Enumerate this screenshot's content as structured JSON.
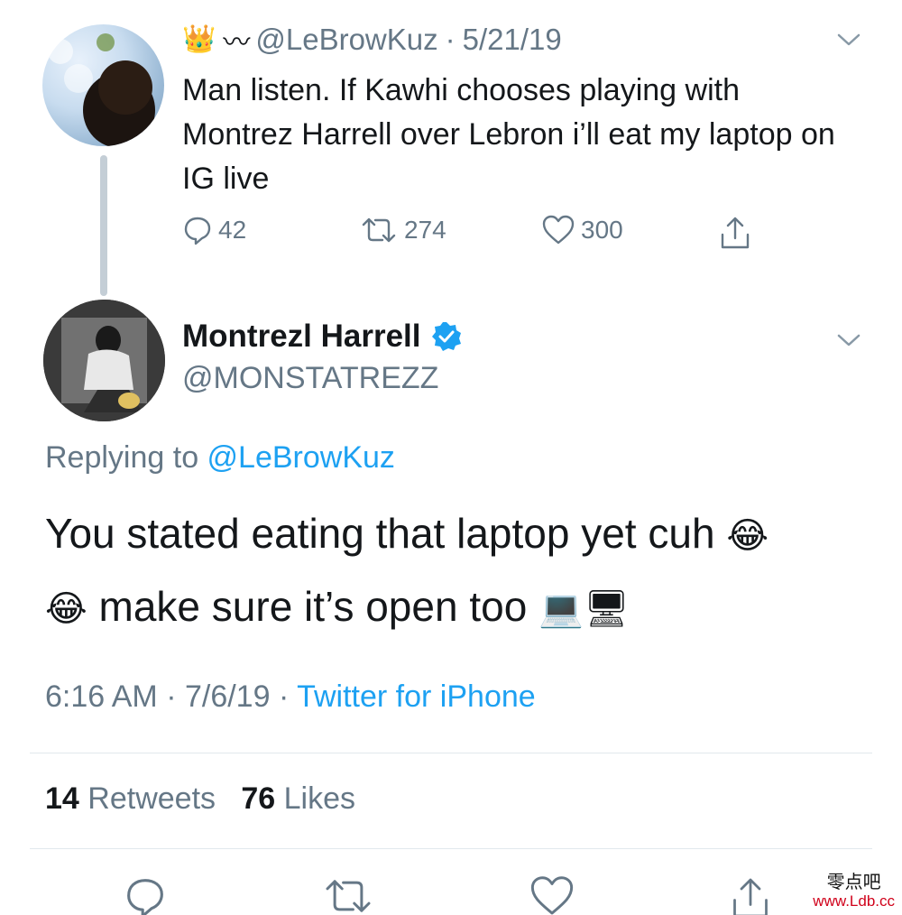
{
  "parent_tweet": {
    "handle": "@LeBrowKuz",
    "date_sep": "·",
    "date": "5/21/19",
    "crown_glyph": "👑",
    "wave_glyph": "〰",
    "text": "Man listen. If Kawhi chooses playing with Montrez Harrell over Lebron i’ll eat my laptop on IG live",
    "replies": "42",
    "retweets": "274",
    "likes": "300"
  },
  "main_tweet": {
    "display_name": "Montrezl Harrell",
    "handle": "@MONSTATREZZ",
    "replying_prefix": "Replying to ",
    "replying_to": "@LeBrowKuz",
    "text_part1": "You stated eating that laptop yet cuh ",
    "emoji_laugh": "😂",
    "text_part2": " make sure it’s open too ",
    "emoji_laptop": "💻",
    "emoji_desktop": "🖥",
    "time": "6:16 AM",
    "meta_sep": " · ",
    "date": "7/6/19",
    "source": "Twitter for iPhone",
    "retweet_count": "14",
    "retweet_label": "Retweets",
    "like_count": "76",
    "like_label": "Likes"
  },
  "watermark": {
    "line1": "零点吧",
    "line2": "www.Ldb.cc"
  },
  "colors": {
    "link": "#1da1f2",
    "muted": "#657786",
    "text": "#14171a",
    "verified": "#1da1f2"
  },
  "icons": [
    "reply-icon",
    "retweet-icon",
    "like-icon",
    "share-icon",
    "chevron-down-icon",
    "verified-badge-icon"
  ]
}
